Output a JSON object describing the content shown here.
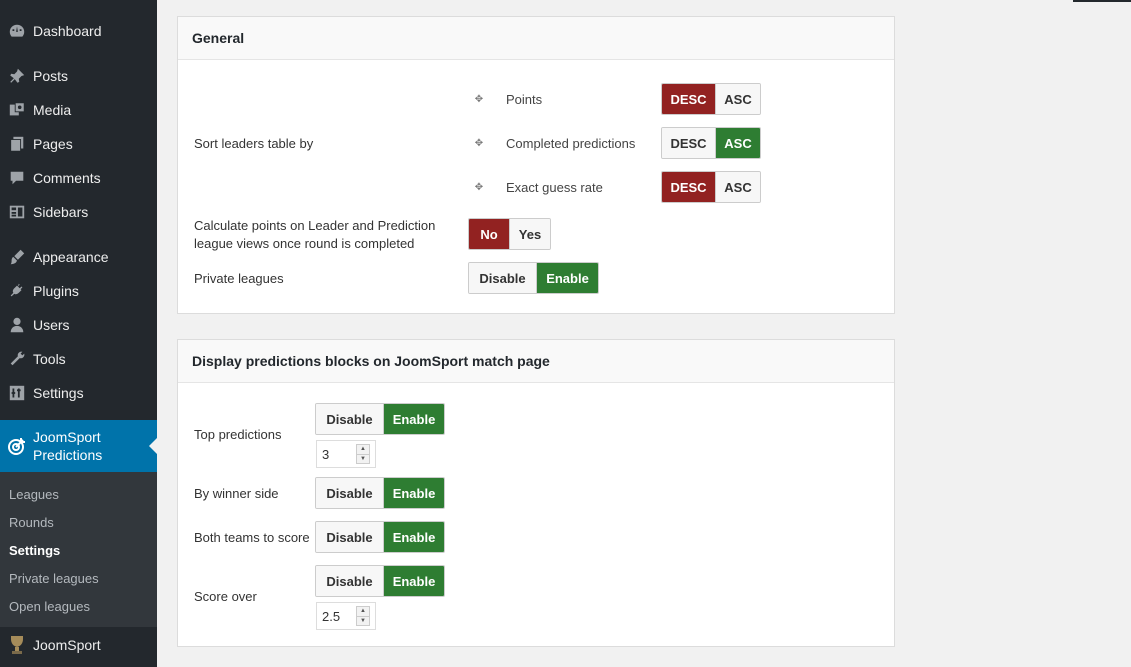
{
  "sidebar": {
    "items": [
      {
        "label": "Dashboard",
        "icon": "dashboard-icon"
      },
      {
        "label": "Posts",
        "icon": "pin-icon"
      },
      {
        "label": "Media",
        "icon": "media-icon"
      },
      {
        "label": "Pages",
        "icon": "pages-icon"
      },
      {
        "label": "Comments",
        "icon": "comment-icon"
      },
      {
        "label": "Sidebars",
        "icon": "sidebars-icon"
      },
      {
        "label": "Appearance",
        "icon": "brush-icon"
      },
      {
        "label": "Plugins",
        "icon": "plug-icon"
      },
      {
        "label": "Users",
        "icon": "user-icon"
      },
      {
        "label": "Tools",
        "icon": "wrench-icon"
      },
      {
        "label": "Settings",
        "icon": "settings-icon"
      }
    ],
    "active": {
      "label_line1": "JoomSport",
      "label_line2": "Predictions",
      "icon": "target-icon"
    },
    "submenu": [
      "Leagues",
      "Rounds",
      "Settings",
      "Private leagues",
      "Open leagues"
    ],
    "bottom": {
      "label": "JoomSport",
      "icon": "trophy-icon"
    }
  },
  "general": {
    "title": "General",
    "sort_label": "Sort leaders table by",
    "sort_rows": [
      {
        "label": "Points",
        "desc": "DESC",
        "asc": "ASC",
        "selected": "DESC"
      },
      {
        "label": "Completed predictions",
        "desc": "DESC",
        "asc": "ASC",
        "selected": "ASC"
      },
      {
        "label": "Exact guess rate",
        "desc": "DESC",
        "asc": "ASC",
        "selected": "DESC"
      }
    ],
    "calc_label": "Calculate points on Leader and Prediction league views once round is completed",
    "calc_no": "No",
    "calc_yes": "Yes",
    "private_label": "Private leagues",
    "disable": "Disable",
    "enable": "Enable"
  },
  "display": {
    "title": "Display predictions blocks on JoomSport match page",
    "top_label": "Top predictions",
    "top_value": "3",
    "winner_label": "By winner side",
    "both_label": "Both teams to score",
    "score_label": "Score over",
    "score_value": "2.5",
    "disable": "Disable",
    "enable": "Enable"
  },
  "colors": {
    "sidebar_bg": "#23282d",
    "active_bg": "#0073aa",
    "red": "#922221",
    "green": "#2e7d32"
  }
}
